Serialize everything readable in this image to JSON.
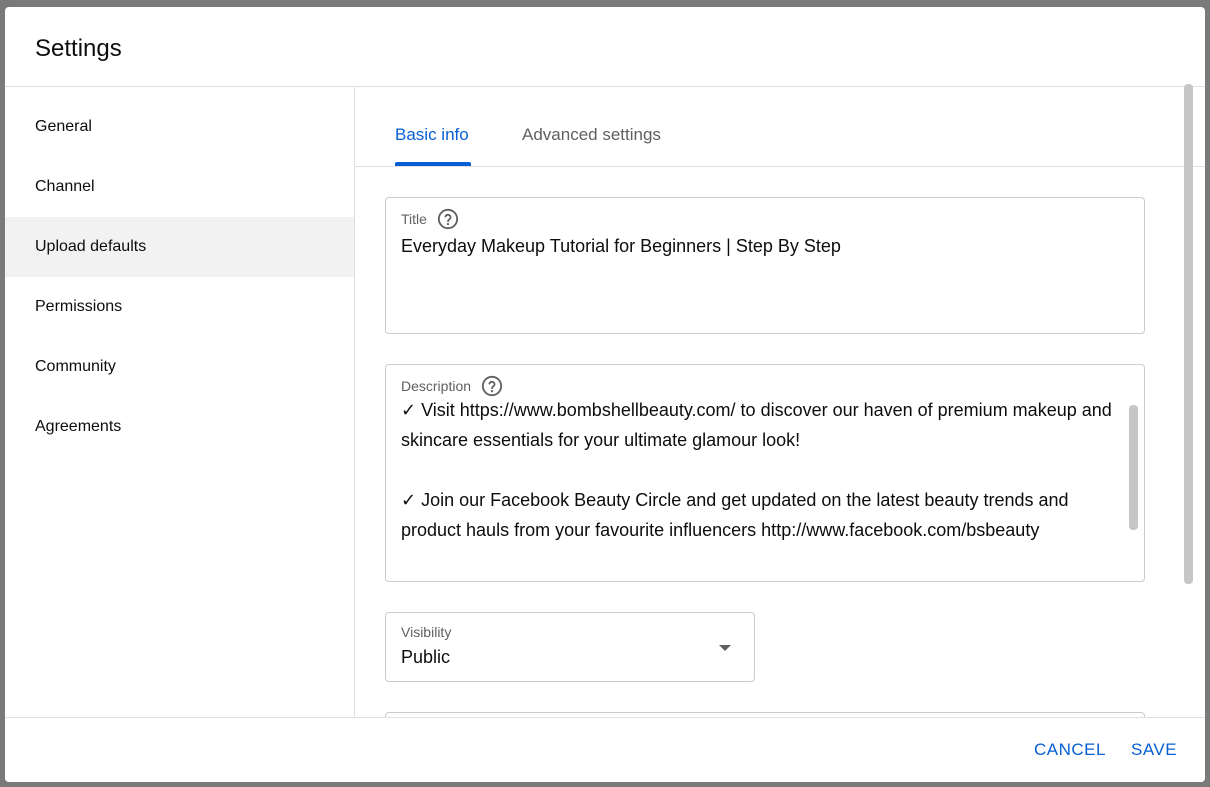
{
  "dialog": {
    "title": "Settings"
  },
  "sidebar": {
    "items": [
      {
        "label": "General"
      },
      {
        "label": "Channel"
      },
      {
        "label": "Upload defaults"
      },
      {
        "label": "Permissions"
      },
      {
        "label": "Community"
      },
      {
        "label": "Agreements"
      }
    ],
    "active_index": 2
  },
  "tabs": [
    {
      "label": "Basic info"
    },
    {
      "label": "Advanced settings"
    }
  ],
  "title_field": {
    "label": "Title",
    "value": "Everyday Makeup Tutorial for Beginners | Step By Step"
  },
  "description_field": {
    "label": "Description",
    "lines": [
      "✓ Visit https://www.bombshellbeauty.com/ to discover our haven of premium makeup and skincare essentials for your ultimate glamour look!",
      "✓ Join our Facebook Beauty Circle and get updated on the latest beauty trends and product hauls from your favourite influencers http://www.facebook.com/bsbeauty"
    ]
  },
  "visibility_field": {
    "label": "Visibility",
    "value": "Public"
  },
  "footer": {
    "cancel_label": "CANCEL",
    "save_label": "SAVE"
  },
  "colors": {
    "accent": "#065fd4",
    "active_bg": "#f2f2f2",
    "border": "#cccccc"
  },
  "icons": {
    "help": "help-circle-icon",
    "dropdown": "caret-down-icon"
  }
}
